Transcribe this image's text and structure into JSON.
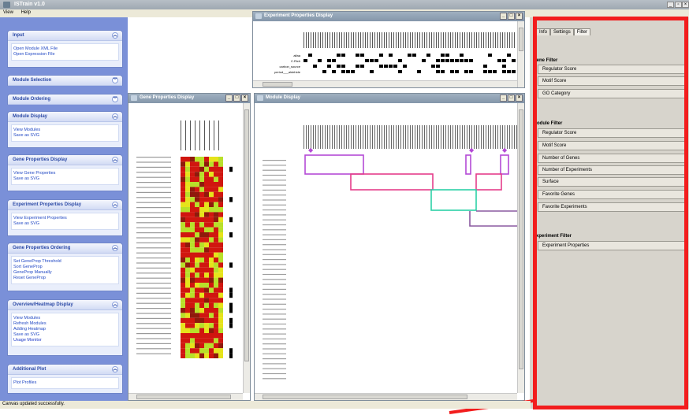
{
  "app": {
    "title": "ISTrain v1.0",
    "menu": [
      "View",
      "Help"
    ],
    "status": "Canvas updated successfully."
  },
  "left_pane": {
    "groups": [
      {
        "title": "Input",
        "items": [
          "Open Module XML File",
          "Open Expression File"
        ]
      },
      {
        "title": "Module Selection",
        "items": []
      },
      {
        "title": "Module Ordering",
        "items": []
      },
      {
        "title": "Module Display",
        "items": [
          "View Modules",
          "Save as SVG"
        ]
      },
      {
        "title": "Gene Properties Display",
        "items": [
          "View Gene Properties",
          "Save as SVG"
        ]
      },
      {
        "title": "Experiment Properties Display",
        "items": [
          "View Experiment Properties",
          "Save as SVG"
        ]
      },
      {
        "title": "Gene Properties Ordering",
        "items": [
          "Set GeneProp Threshold",
          "Sort GeneProp",
          "GeneProp Manually",
          "Reset GeneProp"
        ]
      },
      {
        "title": "Overview/Heatmap Display",
        "items": [
          "View Modules",
          "Refresh Modules",
          "Adding Heatmap",
          "Save as SVG",
          "Usage Monitor"
        ]
      },
      {
        "title": "Additional Plot",
        "items": [
          "Plot Profiles"
        ]
      }
    ]
  },
  "windows": {
    "experiment": {
      "title": "Experiment Properties Display",
      "row_labels": [
        "alfaa",
        "C.Rich",
        "carbon_source",
        "period___aldehide"
      ]
    },
    "gene": {
      "title": "Gene Properties Display"
    },
    "module": {
      "title": "Module Display"
    }
  },
  "right_pane": {
    "tabs": [
      "Info",
      "Settings",
      "Filter"
    ],
    "gene_filter": {
      "title": "Gene Filter",
      "buttons": [
        "Regulator Score",
        "Motif Score",
        "GO Category"
      ]
    },
    "module_filter": {
      "title": "Module Filter",
      "buttons": [
        "Regulator Score",
        "Motif Score",
        "Number of Genes",
        "Number of Experiments",
        "Surface",
        "Favorite Genes",
        "Favorite Experiments"
      ]
    },
    "experiment_filter": {
      "title": "Experiment Filter",
      "buttons": [
        "Experiment Properties"
      ]
    }
  },
  "colors": {
    "highlight": "#f21d1d",
    "heat_red": "#d0160f",
    "heat_yellow": "#e6e31b",
    "module_purple": "#b44ad6",
    "module_pink": "#e53d8a",
    "module_teal": "#2cd0a6",
    "module_violet": "#8a5aa0"
  }
}
